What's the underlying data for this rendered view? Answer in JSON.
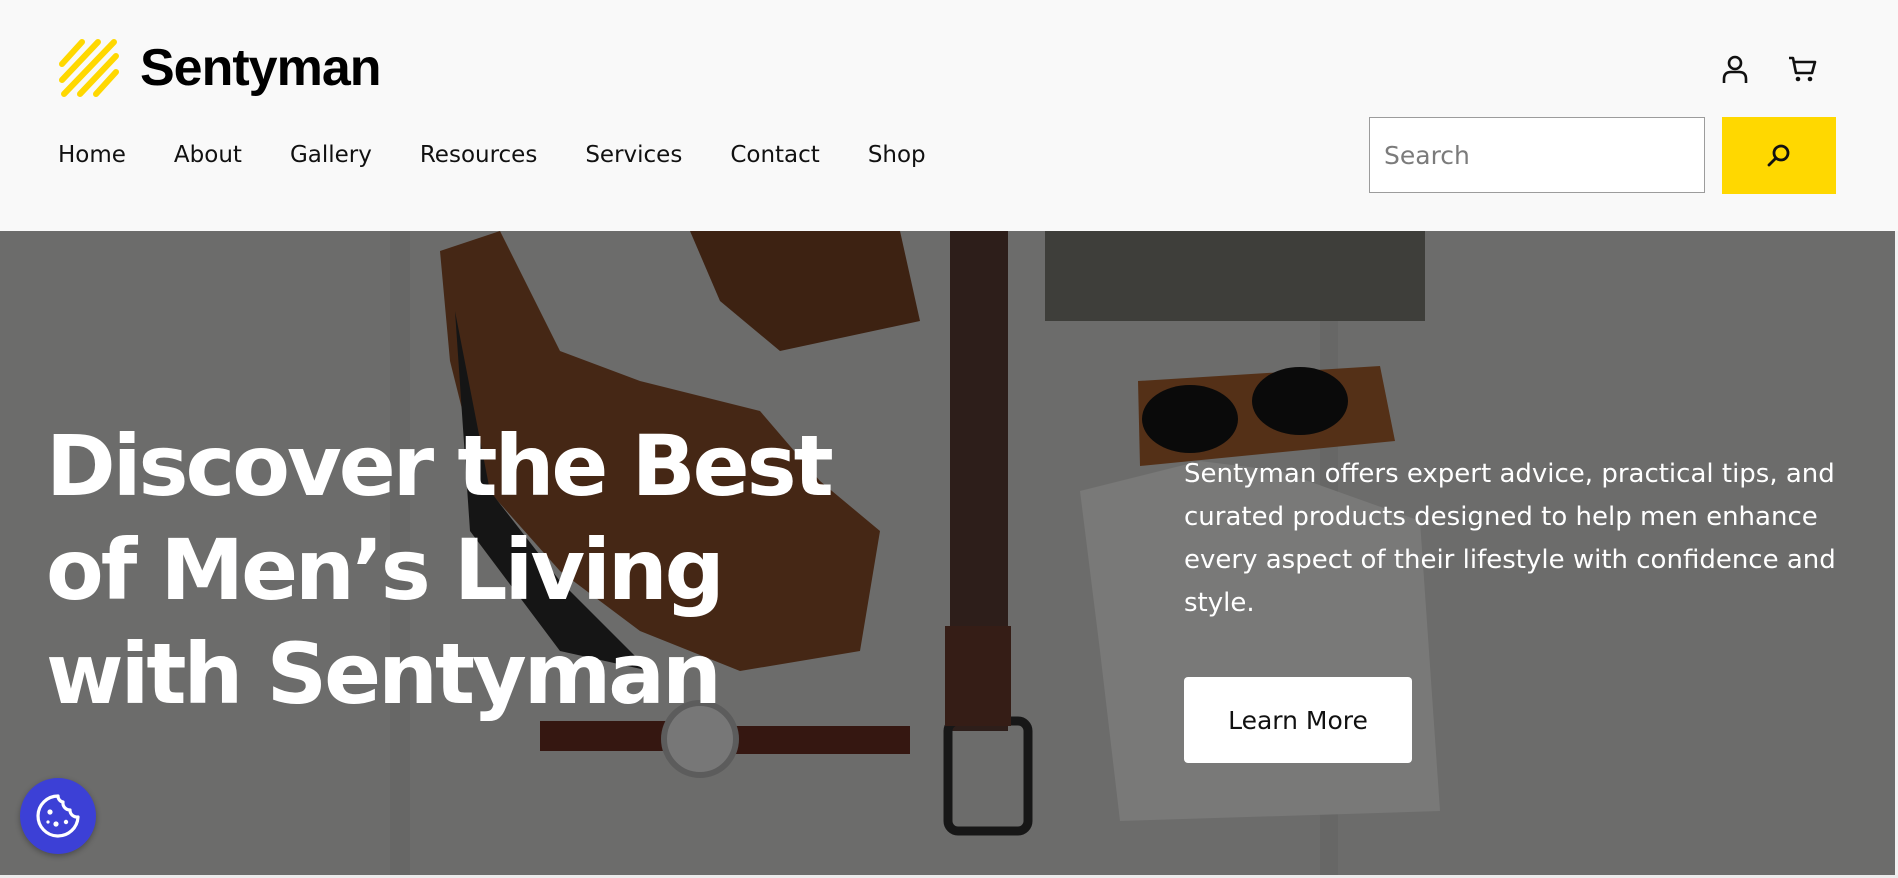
{
  "brand": {
    "name": "Sentyman",
    "logo_icon": "diagonal-stripes-logo",
    "accent_color": "#ffd800"
  },
  "header_icons": {
    "account": "user-icon",
    "cart": "cart-icon"
  },
  "nav": {
    "items": [
      "Home",
      "About",
      "Gallery",
      "Resources",
      "Services",
      "Contact",
      "Shop"
    ]
  },
  "search": {
    "placeholder": "Search",
    "value": "",
    "button_icon": "search-icon",
    "button_color": "#ffd800"
  },
  "hero": {
    "title": "Discover the Best of Men’s Living with Sentyman",
    "description": "Sentyman offers expert advice, practical tips, and curated products designed to help men enhance every aspect of their lifestyle with confidence and style.",
    "cta_label": "Learn More"
  },
  "cookie_button": {
    "icon": "cookie-icon",
    "color": "#3c40d6"
  }
}
